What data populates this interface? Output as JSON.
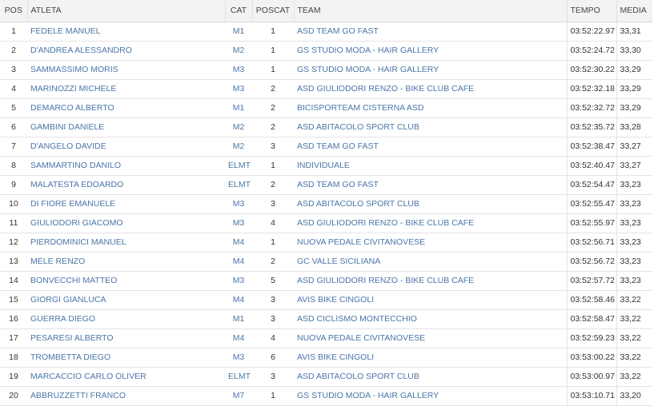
{
  "headers": {
    "pos": "POS",
    "athlete": "ATLETA",
    "cat": "CAT",
    "poscat": "POSCAT",
    "team": "TEAM",
    "time": "TEMPO",
    "avg": "MEDIA"
  },
  "colors": {
    "link": "#4a76a8",
    "header_bg": "#f3f3f3",
    "text": "#333333"
  },
  "rows": [
    {
      "pos": "1",
      "athlete": "FEDELE MANUEL",
      "cat": "M1",
      "poscat": "1",
      "team": "ASD TEAM GO FAST",
      "time": "03:52:22.97",
      "avg": "33,31"
    },
    {
      "pos": "2",
      "athlete": "D'ANDREA ALESSANDRO",
      "cat": "M2",
      "poscat": "1",
      "team": "GS STUDIO MODA - HAIR GALLERY",
      "time": "03:52:24.72",
      "avg": "33,30"
    },
    {
      "pos": "3",
      "athlete": "SAMMASSIMO MORIS",
      "cat": "M3",
      "poscat": "1",
      "team": "GS STUDIO MODA - HAIR GALLERY",
      "time": "03:52:30.22",
      "avg": "33,29"
    },
    {
      "pos": "4",
      "athlete": "MARINOZZI MICHELE",
      "cat": "M3",
      "poscat": "2",
      "team": "ASD GIULIODORI RENZO - BIKE CLUB CAFE",
      "time": "03:52:32.18",
      "avg": "33,29"
    },
    {
      "pos": "5",
      "athlete": "DEMARCO ALBERTO",
      "cat": "M1",
      "poscat": "2",
      "team": "BICISPORTEAM CISTERNA ASD",
      "time": "03:52:32.72",
      "avg": "33,29"
    },
    {
      "pos": "6",
      "athlete": "GAMBINI DANIELE",
      "cat": "M2",
      "poscat": "2",
      "team": "ASD ABITACOLO SPORT CLUB",
      "time": "03:52:35.72",
      "avg": "33,28"
    },
    {
      "pos": "7",
      "athlete": "D'ANGELO DAVIDE",
      "cat": "M2",
      "poscat": "3",
      "team": "ASD TEAM GO FAST",
      "time": "03:52:38.47",
      "avg": "33,27"
    },
    {
      "pos": "8",
      "athlete": "SAMMARTINO DANILO",
      "cat": "ELMT",
      "poscat": "1",
      "team": "INDIVIDUALE",
      "time": "03:52:40.47",
      "avg": "33,27"
    },
    {
      "pos": "9",
      "athlete": "MALATESTA EDOARDO",
      "cat": "ELMT",
      "poscat": "2",
      "team": "ASD TEAM GO FAST",
      "time": "03:52:54.47",
      "avg": "33,23"
    },
    {
      "pos": "10",
      "athlete": "DI FIORE EMANUELE",
      "cat": "M3",
      "poscat": "3",
      "team": "ASD ABITACOLO SPORT CLUB",
      "time": "03:52:55.47",
      "avg": "33,23"
    },
    {
      "pos": "11",
      "athlete": "GIULIODORI GIACOMO",
      "cat": "M3",
      "poscat": "4",
      "team": "ASD GIULIODORI RENZO - BIKE CLUB CAFE",
      "time": "03:52:55.97",
      "avg": "33,23"
    },
    {
      "pos": "12",
      "athlete": "PIERDOMINICI MANUEL",
      "cat": "M4",
      "poscat": "1",
      "team": "NUOVA PEDALE CIVITANOVESE",
      "time": "03:52:56.71",
      "avg": "33,23"
    },
    {
      "pos": "13",
      "athlete": "MELE RENZO",
      "cat": "M4",
      "poscat": "2",
      "team": "GC VALLE SICILIANA",
      "time": "03:52:56.72",
      "avg": "33,23"
    },
    {
      "pos": "14",
      "athlete": "BONVECCHI MATTEO",
      "cat": "M3",
      "poscat": "5",
      "team": "ASD GIULIODORI RENZO - BIKE CLUB CAFE",
      "time": "03:52:57.72",
      "avg": "33,23"
    },
    {
      "pos": "15",
      "athlete": "GIORGI GIANLUCA",
      "cat": "M4",
      "poscat": "3",
      "team": "AVIS BIKE CINGOLI",
      "time": "03:52:58.46",
      "avg": "33,22"
    },
    {
      "pos": "16",
      "athlete": "GUERRA DIEGO",
      "cat": "M1",
      "poscat": "3",
      "team": "ASD CICLISMO MONTECCHIO",
      "time": "03:52:58.47",
      "avg": "33,22"
    },
    {
      "pos": "17",
      "athlete": "PESARESI ALBERTO",
      "cat": "M4",
      "poscat": "4",
      "team": "NUOVA PEDALE CIVITANOVESE",
      "time": "03:52:59.23",
      "avg": "33,22"
    },
    {
      "pos": "18",
      "athlete": "TROMBETTA DIEGO",
      "cat": "M3",
      "poscat": "6",
      "team": "AVIS BIKE CINGOLI",
      "time": "03:53:00.22",
      "avg": "33,22"
    },
    {
      "pos": "19",
      "athlete": "MARCACCIO CARLO OLIVER",
      "cat": "ELMT",
      "poscat": "3",
      "team": "ASD ABITACOLO SPORT CLUB",
      "time": "03:53:00.97",
      "avg": "33,22"
    },
    {
      "pos": "20",
      "athlete": "ABBRUZZETTI FRANCO",
      "cat": "M7",
      "poscat": "1",
      "team": "GS STUDIO MODA - HAIR GALLERY",
      "time": "03:53:10.71",
      "avg": "33,20"
    }
  ]
}
